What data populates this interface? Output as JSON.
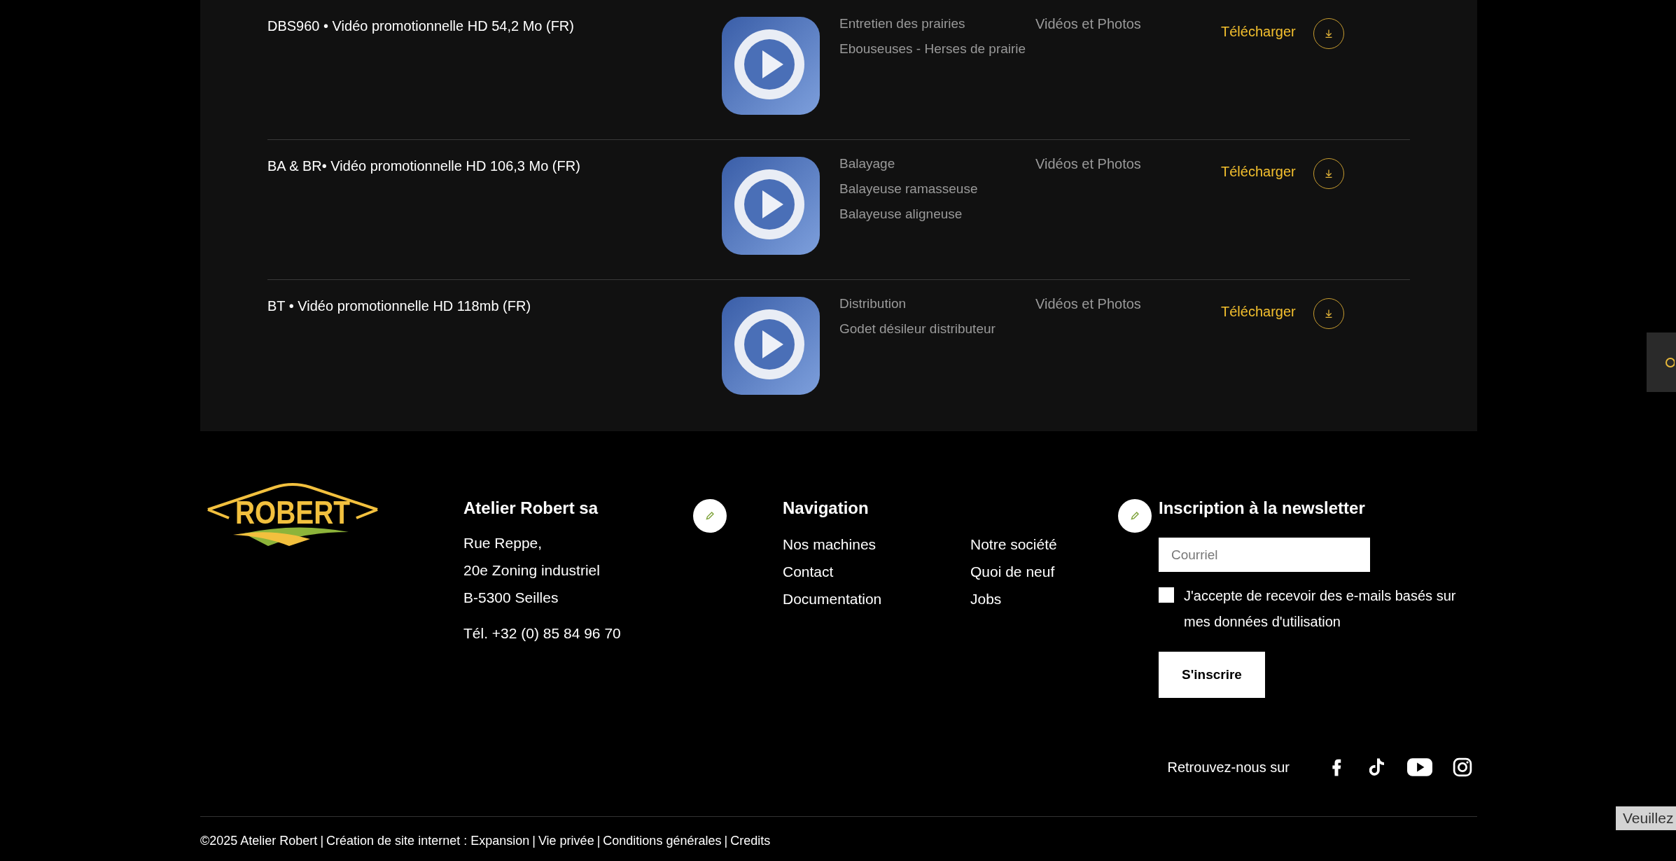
{
  "downloads": [
    {
      "title": "DBS960 • Vidéo promotionnelle HD 54,2 Mo (FR)",
      "categories": [
        "Entretien des prairies",
        "Ebouseuses - Herses de prairie"
      ],
      "type": "Vidéos et Photos",
      "action": "Télécharger"
    },
    {
      "title": "BA & BR• Vidéo promotionnelle HD 106,3 Mo (FR)",
      "categories": [
        "Balayage",
        "Balayeuse ramasseuse",
        "Balayeuse aligneuse"
      ],
      "type": "Vidéos et Photos",
      "action": "Télécharger"
    },
    {
      "title": "BT • Vidéo promotionnelle HD 118mb (FR)",
      "categories": [
        "Distribution",
        "Godet désileur distributeur"
      ],
      "type": "Vidéos et Photos",
      "action": "Télécharger"
    }
  ],
  "footer": {
    "logo_text": "ROBERT",
    "company": {
      "heading": "Atelier Robert sa",
      "address": [
        "Rue Reppe,",
        "20e Zoning industriel",
        "B-5300 Seilles"
      ],
      "phone": "Tél. +32 (0) 85 84 96 70"
    },
    "navigation": {
      "heading": "Navigation",
      "columns": [
        [
          "Nos machines",
          "Contact",
          "Documentation"
        ],
        [
          "Notre société",
          "Quoi de neuf",
          "Jobs"
        ]
      ]
    },
    "newsletter": {
      "heading": "Inscription à la newsletter",
      "email": {
        "placeholder": "Courriel"
      },
      "consent": {
        "label": "J'accepte de recevoir des e-mails basés sur mes données d'utilisation",
        "checked": false
      },
      "button": "S'inscrire"
    },
    "social": {
      "label": "Retrouvez-nous sur",
      "networks": [
        {
          "kind": "facebook"
        },
        {
          "kind": "tiktok"
        },
        {
          "kind": "youtube"
        },
        {
          "kind": "instagram"
        }
      ]
    },
    "legal": {
      "separator": "|",
      "links": [
        "©2025 Atelier Robert",
        "Création de site internet : Expansion",
        "Vie privée",
        "Conditions générales",
        "Credits"
      ]
    }
  },
  "notice_tab": {
    "text": "Veuillez"
  }
}
